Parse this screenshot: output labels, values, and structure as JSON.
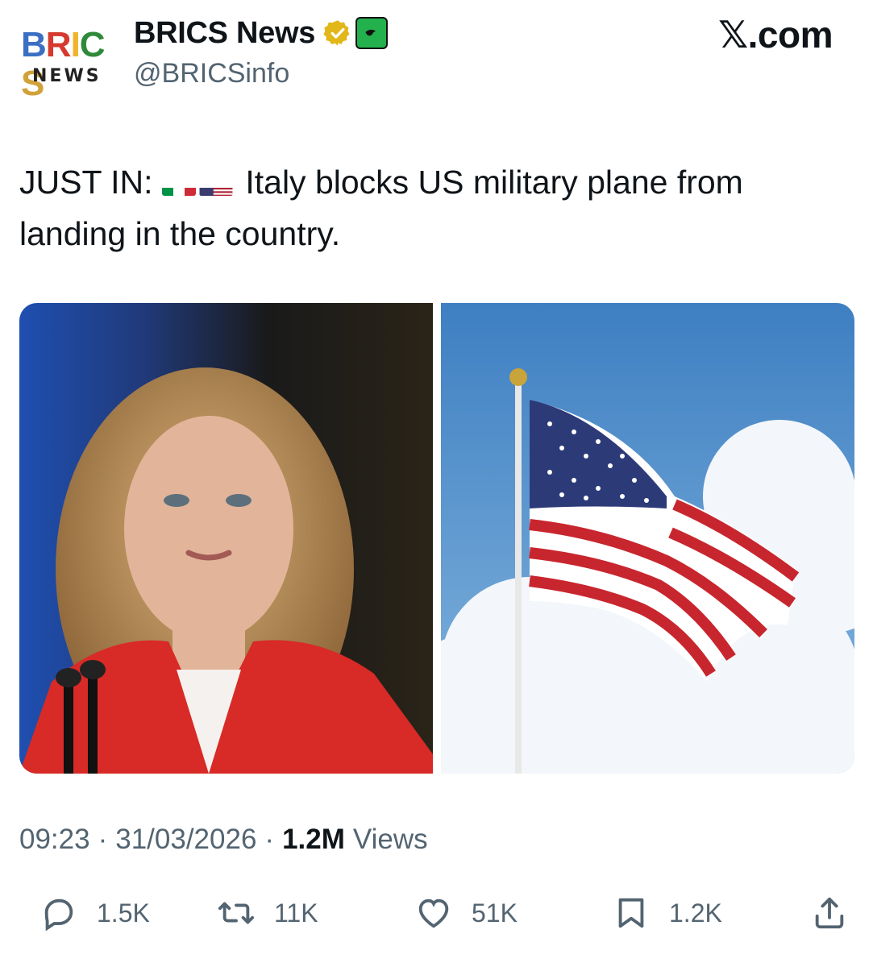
{
  "header": {
    "avatar_top": "BRICS",
    "avatar_bottom": "NEWS",
    "display_name": "BRICS News",
    "handle": "@BRICSinfo",
    "brand": "𝕏.com"
  },
  "tweet": {
    "prefix": "JUST IN:",
    "flags": [
      "italy-flag",
      "us-flag"
    ],
    "text": "Italy blocks US military plane from landing in the country.",
    "images": [
      {
        "name": "politician-photo",
        "alt": "woman in red jacket at podium"
      },
      {
        "name": "us-flag-photo",
        "alt": "US flag waving against sky"
      }
    ]
  },
  "meta": {
    "time": "09:23",
    "date": "31/03/2026",
    "views_count": "1.2M",
    "views_label": "Views"
  },
  "actions": {
    "replies": "1.5K",
    "reposts": "11K",
    "likes": "51K",
    "bookmarks": "1.2K"
  },
  "colors": {
    "text": "#0f1419",
    "secondary": "#536471",
    "verified": "#e2b719",
    "affiliate": "#22b14c"
  }
}
